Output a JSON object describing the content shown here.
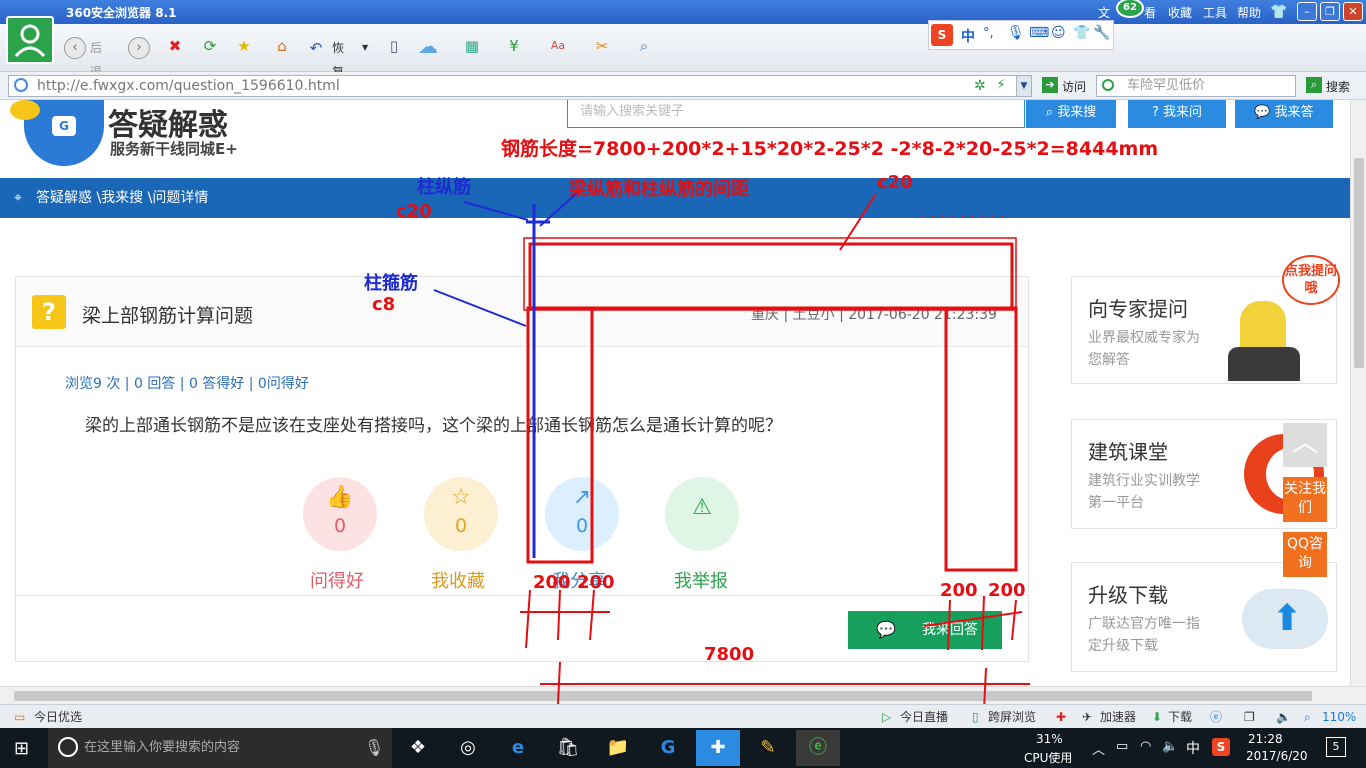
{
  "browser": {
    "title": "360安全浏览器 8.1",
    "badge": "62",
    "menu": [
      "文",
      "看",
      "收藏",
      "工具",
      "帮助"
    ],
    "back_label": "后退",
    "restore_label": "恢复",
    "url": "http://e.fwxgx.com/question_1596610.html",
    "go_label": "访问",
    "search_placeholder": "车险罕见低价",
    "search_label": "搜索",
    "ime_items": [
      "中",
      "°,"
    ]
  },
  "site": {
    "logo_title": "答疑解惑",
    "logo_sub": "服务新干线同城E+",
    "search_placeholder": "请输入搜索关键子",
    "buttons": [
      "我来搜",
      "我来问",
      "我来答"
    ],
    "breadcrumb": "答疑解惑 \\我来搜 \\问题详情"
  },
  "question": {
    "title": "梁上部钢筋计算问题",
    "meta": "重庆 | 土豆小 | 2017-06-20 21:23:39",
    "stats": "浏览9 次 | 0 回答 | 0 答得好 | 0问得好",
    "body": "梁的上部通长钢筋不是应该在支座处有搭接吗，这个梁的上部通长钢筋怎么是通长计算的呢？",
    "actions": [
      {
        "label": "问得好",
        "count": "0",
        "icon": "thumbs-up-icon"
      },
      {
        "label": "我收藏",
        "count": "0",
        "icon": "star-icon"
      },
      {
        "label": "我分享",
        "count": "0",
        "icon": "share-icon"
      },
      {
        "label": "我举报",
        "count": "",
        "icon": "warning-icon"
      }
    ],
    "answer_button": "我来回答"
  },
  "sidebar": [
    {
      "title": "向专家提问",
      "desc": "业界最权威专家为您解答",
      "bubble": "点我提问哦"
    },
    {
      "title": "建筑课堂",
      "desc": "建筑行业实训教学第一平台"
    },
    {
      "title": "升级下载",
      "desc": "广联达官方唯一指定升级下载"
    }
  ],
  "float_buttons": [
    "关注我们",
    "QQ咨询"
  ],
  "annotations": {
    "formula": "钢筋长度=7800+200*2+15*20*2-25*2 -2*8-2*20-25*2=8444mm",
    "col_long": "柱纵筋",
    "c20_left": "c20",
    "gap_label": "梁纵筋和柱纵筋的间距",
    "c20_right": "c20",
    "col_stirrup": "柱箍筋",
    "c8": "c8",
    "dim_200a": "200",
    "dim_200b": "200",
    "dim_200c": "200",
    "dim_200d": "200",
    "dim_7800": "7800"
  },
  "statusbar": {
    "left": "今日优选",
    "items": [
      "今日直播",
      "跨屏浏览",
      "加速器",
      "下载"
    ],
    "zoom": "110%"
  },
  "taskbar": {
    "search_placeholder": "在这里输入你要搜索的内容",
    "cpu_percent": "31%",
    "cpu_label": "CPU使用",
    "ime": "中",
    "time": "21:28",
    "date": "2017/6/20",
    "notification_count": "5"
  },
  "colors": {
    "annotation_red": "#e40f12",
    "annotation_blue": "#1e2bd4",
    "nav_blue": "#1a67b7",
    "answer_green": "#17a05d"
  }
}
